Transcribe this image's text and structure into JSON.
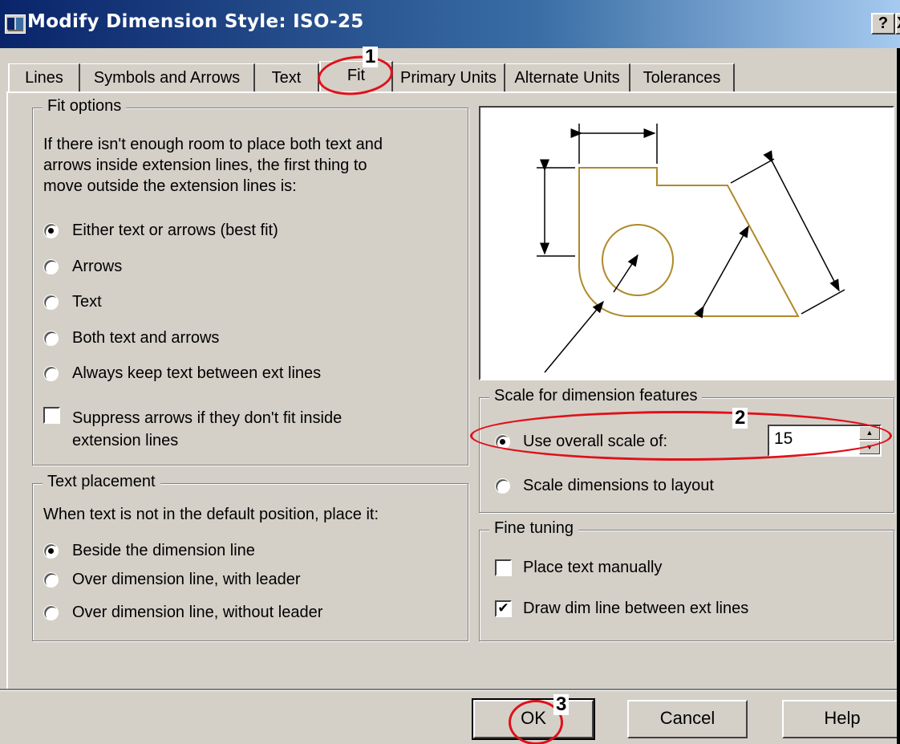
{
  "window": {
    "title": "Modify Dimension Style: ISO-25",
    "help_label": "?",
    "close_label": "X"
  },
  "tabs": [
    {
      "label": "Lines"
    },
    {
      "label": "Symbols and Arrows"
    },
    {
      "label": "Text"
    },
    {
      "label": "Fit",
      "active": true
    },
    {
      "label": "Primary Units"
    },
    {
      "label": "Alternate Units"
    },
    {
      "label": "Tolerances"
    }
  ],
  "fit_options": {
    "title": "Fit options",
    "description_lines": [
      "If there isn't enough room to place both text and",
      "arrows inside extension lines, the first thing to",
      "move outside the extension lines is:"
    ],
    "options": [
      {
        "label": "Either text or arrows (best fit)",
        "selected": true
      },
      {
        "label": "Arrows",
        "selected": false
      },
      {
        "label": "Text",
        "selected": false
      },
      {
        "label": "Both text and arrows",
        "selected": false
      },
      {
        "label": "Always keep text between ext lines",
        "selected": false
      }
    ],
    "suppress_lines": [
      "Suppress arrows if they don't fit inside",
      "extension lines"
    ],
    "suppress_checked": false
  },
  "text_placement": {
    "title": "Text placement",
    "description": "When text is not in the default position, place it:",
    "options": [
      {
        "label": "Beside the dimension line",
        "selected": true
      },
      {
        "label": "Over dimension line, with leader",
        "selected": false
      },
      {
        "label": "Over dimension line, without leader",
        "selected": false
      }
    ]
  },
  "scale": {
    "title": "Scale for dimension features",
    "overall_label": "Use overall scale of:",
    "overall_selected": true,
    "overall_value": "15",
    "layout_label": "Scale dimensions to layout",
    "layout_selected": false
  },
  "fine_tuning": {
    "title": "Fine tuning",
    "manual_label": "Place text manually",
    "manual_checked": false,
    "dimline_label": "Draw dim line between ext lines",
    "dimline_checked": true
  },
  "buttons": {
    "ok": "OK",
    "cancel": "Cancel",
    "help": "Help"
  },
  "annotations": {
    "one": "1",
    "two": "2",
    "three": "3",
    "color": "#e0101a"
  },
  "colors": {
    "title_bar": "#0a246a",
    "dialog": "#d4d0c8",
    "preview_shape": "#b08a2a"
  },
  "glyphs": {
    "check": "✔",
    "spin_up": "▲",
    "spin_down": "▼"
  }
}
